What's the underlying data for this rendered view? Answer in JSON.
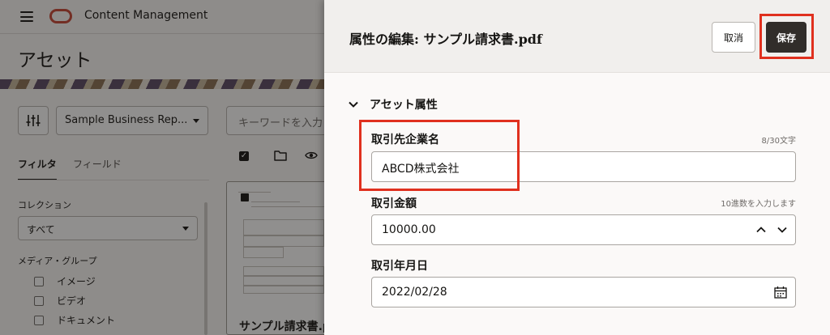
{
  "app": {
    "title": "Content Management",
    "page_title": "アセット"
  },
  "background": {
    "repository_select": "Sample Business Rep...",
    "search_placeholder": "キーワードを入力",
    "tabs": [
      "フィルタ",
      "フィールド"
    ],
    "collection_label": "コレクション",
    "collection_value": "すべて",
    "media_group_label": "メディア・グループ",
    "media_items": [
      "イメージ",
      "ビデオ",
      "ドキュメント"
    ],
    "card_title": "サンプル請求書.pdf"
  },
  "drawer": {
    "title": "属性の編集: サンプル請求書.pdf",
    "cancel_label": "取消",
    "save_label": "保存",
    "section_title": "アセット属性",
    "fields": [
      {
        "label": "取引先企業名",
        "hint": "8/30文字",
        "value": "ABCD株式会社"
      },
      {
        "label": "取引金額",
        "hint": "10進数を入力します",
        "value": "10000.00"
      },
      {
        "label": "取引年月日",
        "hint": "",
        "value": "2022/02/28"
      }
    ]
  },
  "colors": {
    "brand_red": "#c74634",
    "highlight_red": "#e0301e",
    "primary_button": "#312d2a"
  },
  "icons": [
    "menu-icon",
    "oracle-logo",
    "filter-sliders-icon",
    "chevron-down-icon",
    "folder-icon",
    "eye-icon",
    "chevron-up-icon",
    "calendar-icon"
  ]
}
